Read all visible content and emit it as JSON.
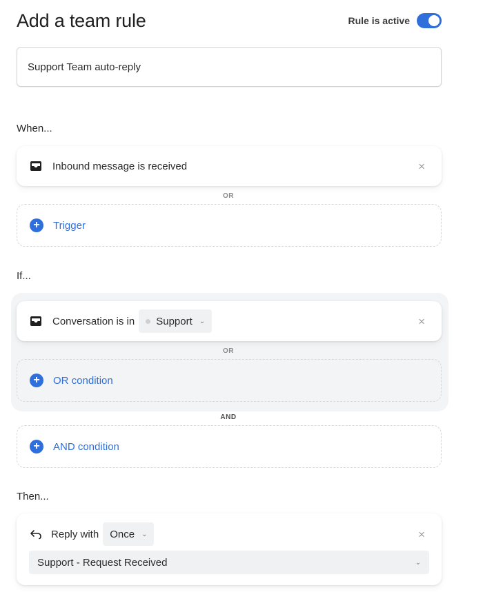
{
  "header": {
    "title": "Add a team rule",
    "active_label": "Rule is active",
    "active": true
  },
  "rule_name": {
    "value": "Support Team auto-reply"
  },
  "when": {
    "label": "When...",
    "trigger_text": "Inbound message is received",
    "or_label": "OR",
    "add_trigger_label": "Trigger"
  },
  "if": {
    "label": "If...",
    "condition_text": "Conversation is in",
    "condition_value": "Support",
    "or_label": "OR",
    "add_or_label": "OR condition",
    "and_label": "AND",
    "add_and_label": "AND condition"
  },
  "then": {
    "label": "Then...",
    "action_text": "Reply with",
    "frequency": "Once",
    "template": "Support - Request Received"
  },
  "icons": {
    "close": "×",
    "chevron": "⌄",
    "plus": "+"
  },
  "colors": {
    "accent": "#2f6fdc",
    "if_group_bg": "#f3f4f5"
  }
}
